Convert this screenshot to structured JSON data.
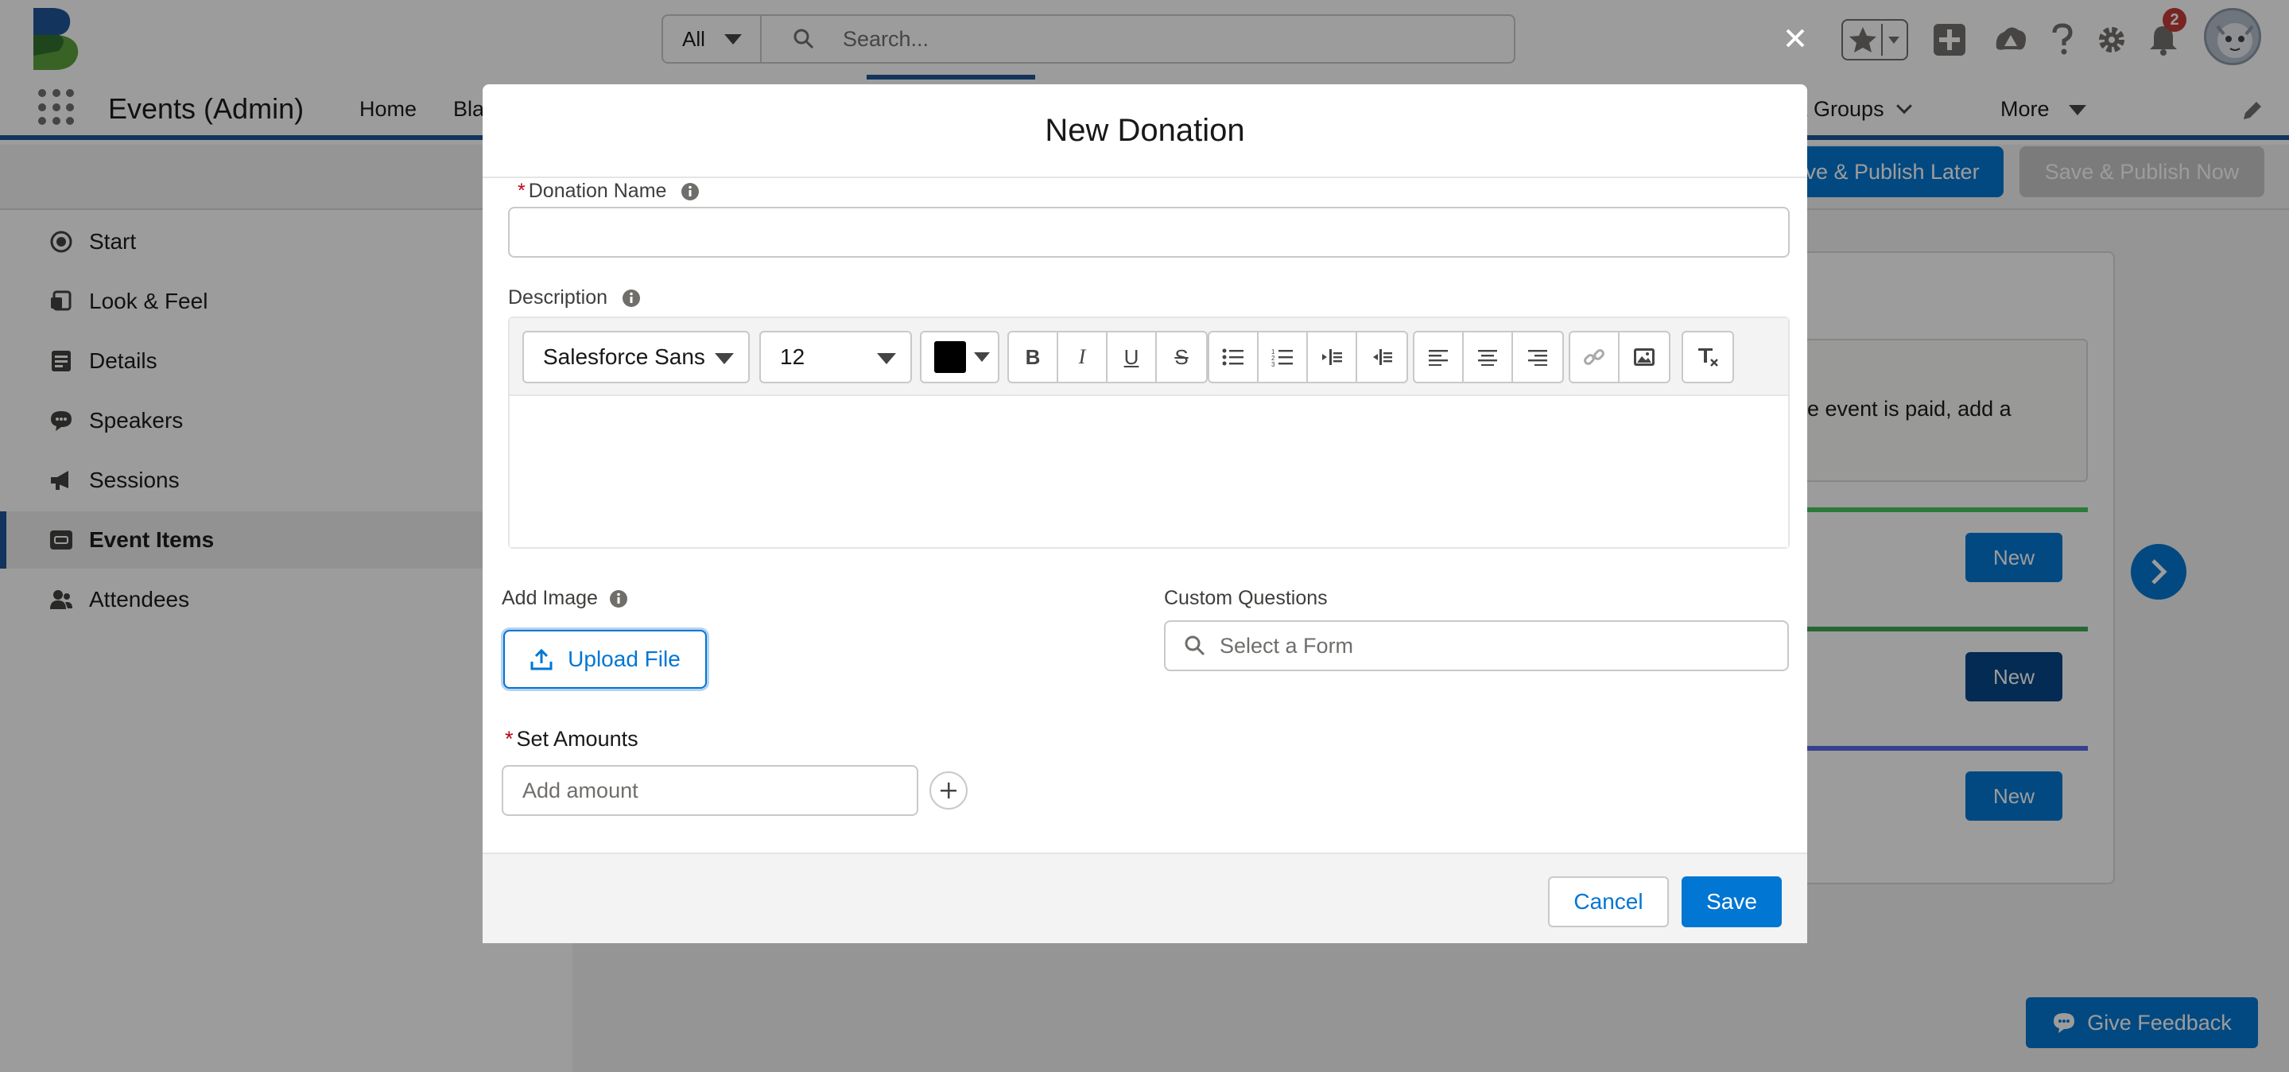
{
  "app": {
    "name": "Events (Admin)",
    "notification_count": "2"
  },
  "search": {
    "scope": "All",
    "placeholder": "Search..."
  },
  "nav": {
    "items": [
      "Home",
      "Bla",
      "ent Groups",
      "More"
    ]
  },
  "subheader": {
    "publish_later": "ve & Publish Later",
    "publish_now": "Save & Publish Now"
  },
  "sidebar": {
    "items": [
      {
        "label": "Start",
        "icon": "target-icon"
      },
      {
        "label": "Look & Feel",
        "icon": "paint-icon"
      },
      {
        "label": "Details",
        "icon": "details-icon"
      },
      {
        "label": "Speakers",
        "icon": "chat-icon"
      },
      {
        "label": "Sessions",
        "icon": "megaphone-icon"
      },
      {
        "label": "Event Items",
        "icon": "ticket-icon",
        "active": true
      },
      {
        "label": "Attendees",
        "icon": "people-icon"
      }
    ]
  },
  "background_content": {
    "info_text_line1": "he event is paid, add a",
    "new_buttons": [
      "New",
      "New",
      "New"
    ],
    "feedback": "Give Feedback"
  },
  "modal": {
    "title": "New Donation",
    "donation_name": {
      "label": "Donation Name",
      "required": "*",
      "value": ""
    },
    "description": {
      "label": "Description"
    },
    "toolbar": {
      "font": "Salesforce Sans",
      "size": "12",
      "color": "#000000",
      "bold": "B",
      "italic": "I",
      "underline": "U",
      "strike": "S"
    },
    "add_image": {
      "label": "Add Image",
      "button": "Upload File"
    },
    "custom_questions": {
      "label": "Custom Questions",
      "placeholder": "Select a Form"
    },
    "set_amounts": {
      "label": "Set Amounts",
      "required": "*",
      "placeholder": "Add amount"
    },
    "footer": {
      "cancel": "Cancel",
      "save": "Save"
    }
  },
  "colors": {
    "brand": "#0176d3",
    "nav_accent": "#1b5297",
    "required": "#ba0517"
  }
}
